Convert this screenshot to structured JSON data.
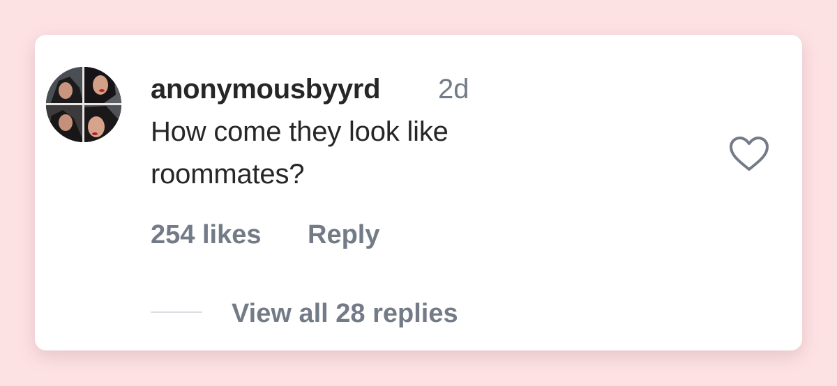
{
  "comment": {
    "username": "anonymousbyyrd",
    "timestamp": "2d",
    "text_line1": "How come they look like",
    "text_line2": "roommates?",
    "likes": "254 likes",
    "reply_label": "Reply",
    "view_replies": "View all 28 replies",
    "like_icon": "heart-outline-icon",
    "avatar_icon": "user-avatar-photo-collage"
  },
  "colors": {
    "page_background": "#fde2e4",
    "card_background": "#ffffff",
    "primary_text": "#262626",
    "secondary_text": "#737b87",
    "divider": "#dcdfe3"
  }
}
